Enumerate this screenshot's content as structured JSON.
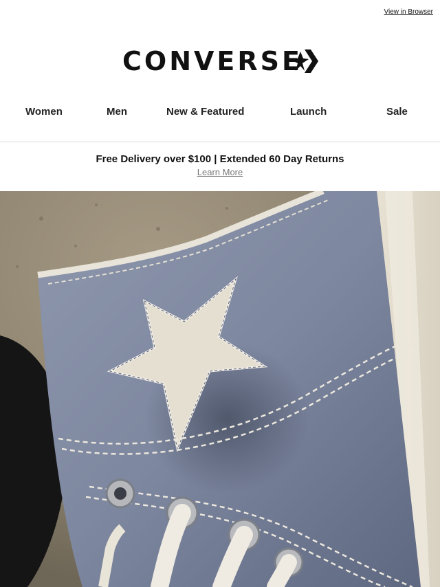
{
  "header": {
    "view_in_browser": "View in Browser",
    "brand": "CONVERSE"
  },
  "nav": {
    "items": [
      {
        "label": "Women"
      },
      {
        "label": "Men"
      },
      {
        "label": "New & Featured"
      },
      {
        "label": "Launch"
      },
      {
        "label": "Sale"
      }
    ]
  },
  "promo": {
    "title": "Free Delivery over $100 | Extended 60 Day Returns",
    "link": "Learn More"
  },
  "hero": {
    "image_subject": "close-up of grey-blue canvas high-top sneaker with star patch"
  },
  "colors": {
    "text": "#111111",
    "link_gray": "#777777",
    "divider": "#d9d9d9",
    "canvas_blue": "#7f8aa4"
  }
}
